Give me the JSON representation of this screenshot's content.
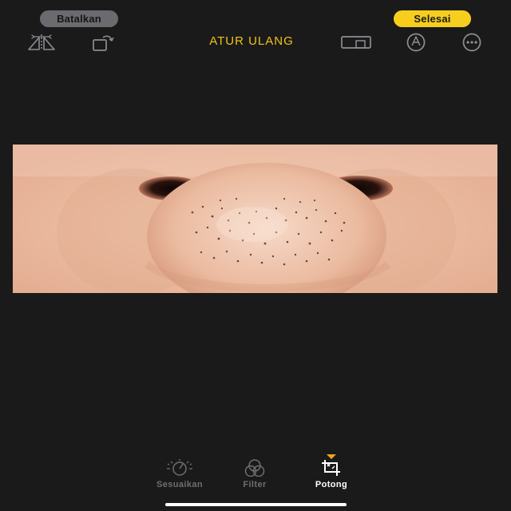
{
  "header": {
    "cancel_label": "Batalkan",
    "done_label": "Selesai",
    "reset_label": "ATUR ULANG"
  },
  "toolbar_icons": [
    "flip-horizontal-icon",
    "rotate-icon",
    "aspect-ratio-icon",
    "markup-icon",
    "more-icon"
  ],
  "bottom_tabs": [
    {
      "label": "Sesuaikan",
      "icon": "adjust-dial-icon",
      "active": false
    },
    {
      "label": "Filter",
      "icon": "filter-circles-icon",
      "active": false
    },
    {
      "label": "Potong",
      "icon": "crop-icon",
      "active": true
    }
  ],
  "colors": {
    "accent": "#f7ce1d",
    "reset_text": "#f2c31a",
    "background": "#1a1a1a",
    "inactive_text": "#6f6f72",
    "indicator": "#f2a51a"
  },
  "photo": {
    "subject": "close-up photo"
  }
}
